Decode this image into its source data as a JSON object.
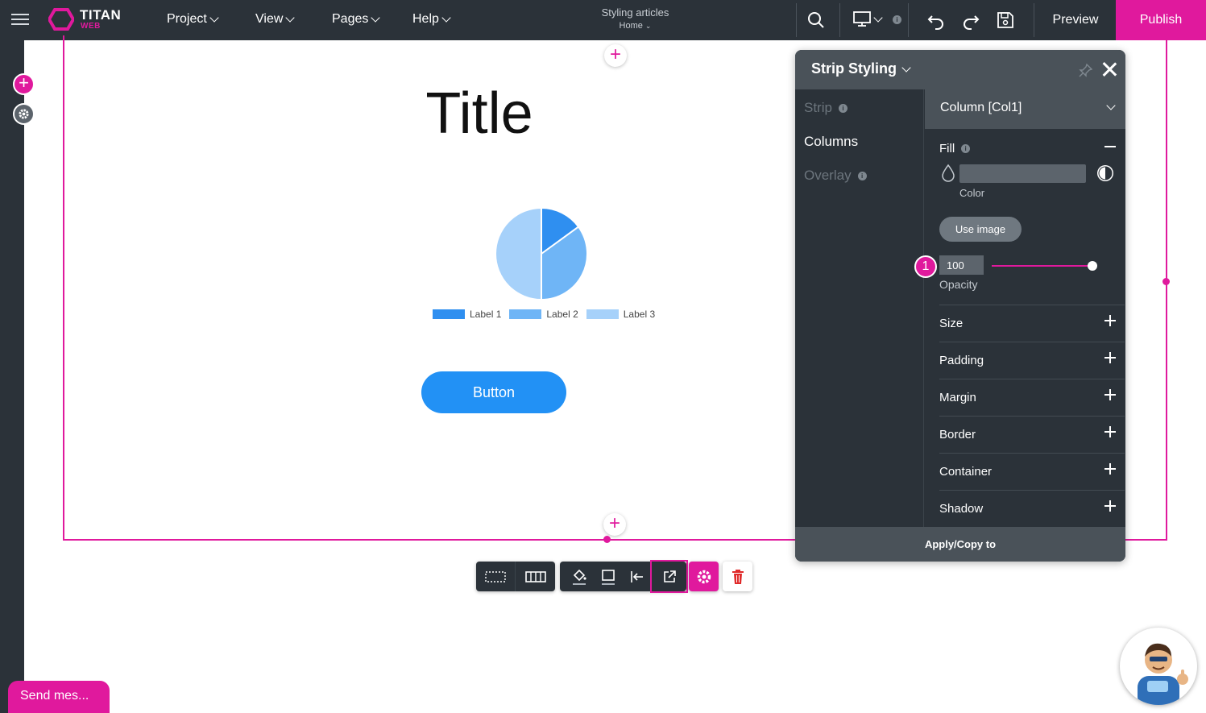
{
  "app": {
    "brand": "TITAN",
    "brand_sub": "WEB"
  },
  "menu": {
    "project": "Project",
    "view": "View",
    "pages": "Pages",
    "help": "Help"
  },
  "project": {
    "title": "Styling articles",
    "page": "Home"
  },
  "toolbar": {
    "device_info": "i",
    "preview": "Preview",
    "publish": "Publish"
  },
  "canvas": {
    "title": "Title",
    "button_label": "Button"
  },
  "chart_data": {
    "type": "pie",
    "labels": [
      "Label 1",
      "Label 2",
      "Label 3"
    ],
    "values": [
      15,
      35,
      50
    ],
    "colors": [
      "#2f8ff0",
      "#6fb5f6",
      "#a6d1fa"
    ]
  },
  "panel": {
    "title": "Strip Styling",
    "nav": [
      {
        "label": "Strip",
        "info": "i",
        "active": false
      },
      {
        "label": "Columns",
        "info": "",
        "active": true
      },
      {
        "label": "Overlay",
        "info": "i",
        "active": false
      }
    ],
    "column_select": "Column [Col1]",
    "fill": {
      "label": "Fill",
      "info": "i",
      "color_label": "Color",
      "use_image": "Use image",
      "opacity_value": "100",
      "opacity_label": "Opacity",
      "opacity_fraction": 1.0
    },
    "sections": [
      "Size",
      "Padding",
      "Margin",
      "Border",
      "Container",
      "Shadow"
    ],
    "apply": "Apply/Copy to"
  },
  "badge": {
    "step": "1"
  },
  "chat": {
    "send_message": "Send mes..."
  },
  "colors": {
    "accent": "#e0199d",
    "dark": "#2b3239",
    "button_blue": "#2291f5"
  }
}
